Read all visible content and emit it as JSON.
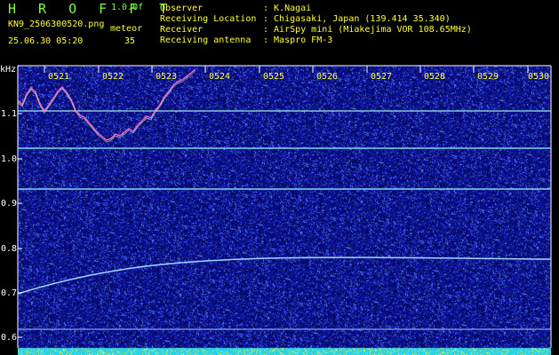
{
  "header": {
    "app_name": "H R O F F T",
    "version": "1.0.0f",
    "file_name": "KN9_2506300520.png",
    "meteor_label": "meteor",
    "datetime": "25.06.30 05:20",
    "meteor_count": "35",
    "info": [
      {
        "label": "Observer",
        "value": ": K.Nagai"
      },
      {
        "label": "Receiving Location",
        "value": ": Chigasaki, Japan (139.414 35.340)"
      },
      {
        "label": "Receiver",
        "value": ": AirSpy mini (Miakejima VOR 108.65MHz)"
      },
      {
        "label": "Receiving antenna",
        "value": ": Maspro FM-3"
      }
    ]
  },
  "axis": {
    "unit": "kHz",
    "y_ticks": [
      "1.1",
      "1.0",
      "0.9",
      "0.8",
      "0.7",
      "0.6"
    ],
    "time_ticks": [
      "0521",
      "0522",
      "0523",
      "0524",
      "0525",
      "0526",
      "0527",
      "0528",
      "0529",
      "0530"
    ]
  },
  "colors": {
    "background": "#000000",
    "spectrogram": "#1a1f8c",
    "label_green": "#7dff3c",
    "label_yellow": "#ffff33",
    "trace": "#ff66cc",
    "carrier": "#7ad7e8"
  }
}
